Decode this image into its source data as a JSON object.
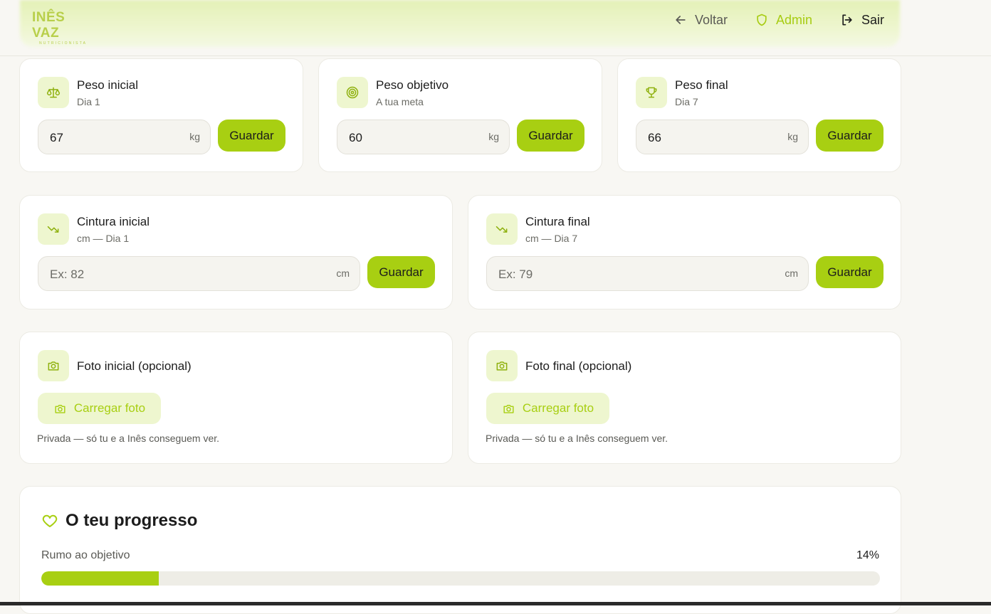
{
  "brand": {
    "name": "INÊS VAZ",
    "subtitle": "NUTRICIONISTA"
  },
  "nav": {
    "back": "Voltar",
    "admin": "Admin",
    "logout": "Sair"
  },
  "weight_cards": [
    {
      "title": "Peso inicial",
      "subtitle": "Dia 1",
      "value": "67",
      "unit": "kg",
      "button": "Guardar",
      "icon": "scale-icon"
    },
    {
      "title": "Peso objetivo",
      "subtitle": "A tua meta",
      "value": "60",
      "unit": "kg",
      "button": "Guardar",
      "icon": "target-icon"
    },
    {
      "title": "Peso final",
      "subtitle": "Dia 7",
      "value": "66",
      "unit": "kg",
      "button": "Guardar",
      "icon": "trophy-icon"
    }
  ],
  "waist_cards": [
    {
      "title": "Cintura inicial",
      "subtitle": "cm — Dia 1",
      "placeholder": "Ex: 82",
      "unit": "cm",
      "button": "Guardar",
      "icon": "trending-down-icon"
    },
    {
      "title": "Cintura final",
      "subtitle": "cm — Dia 7",
      "placeholder": "Ex: 79",
      "unit": "cm",
      "button": "Guardar",
      "icon": "trending-down-icon"
    }
  ],
  "photo_cards": [
    {
      "title": "Foto inicial (opcional)",
      "button": "Carregar foto",
      "note": "Privada — só tu e a Inês conseguem ver.",
      "icon": "camera-icon"
    },
    {
      "title": "Foto final (opcional)",
      "button": "Carregar foto",
      "note": "Privada — só tu e a Inês conseguem ver.",
      "icon": "camera-icon"
    }
  ],
  "progress": {
    "title": "O teu progresso",
    "label": "Rumo ao objetivo",
    "percent_text": "14%",
    "percent": 14
  },
  "colors": {
    "accent": "#a8cf12",
    "accent_soft": "#eef6cf",
    "background": "#f8f7f3"
  }
}
